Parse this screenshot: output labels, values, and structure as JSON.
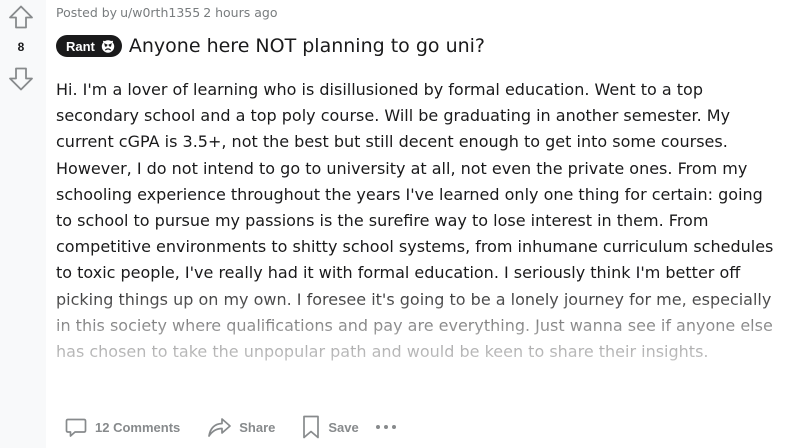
{
  "post": {
    "score": "8",
    "meta": {
      "posted_by": "Posted by",
      "author": "u/w0rth1355",
      "time": "2 hours ago"
    },
    "flair": {
      "label": "Rant",
      "icon": "angry-face-emoji-icon"
    },
    "title": "Anyone here NOT planning to go uni?",
    "body": "Hi. I'm a lover of learning who is disillusioned by formal education. Went to a top secondary school and a top poly course. Will be graduating in another semester. My current cGPA is 3.5+, not the best but still decent enough to get into some courses. However, I do not intend to go to university at all, not even the private ones. From my schooling experience throughout the years I've learned only one thing for certain: going to school to pursue my passions is the surefire way to lose interest in them. From competitive environments to shitty school systems, from inhumane curriculum schedules to toxic people, I've really had it with formal education. I seriously think I'm better off picking things up on my own. I foresee it's going to be a lonely journey for me, especially in this society where qualifications and pay are everything. Just wanna see if anyone else has chosen to take the unpopular path and would be keen to share their insights."
  },
  "actions": {
    "comments_label": "12 Comments",
    "share_label": "Share",
    "save_label": "Save"
  },
  "icons": {
    "upvote": "upvote-arrow-icon",
    "downvote": "downvote-arrow-icon",
    "comments": "comment-bubble-icon",
    "share": "share-arrow-icon",
    "save": "bookmark-icon",
    "more": "more-options-icon"
  },
  "colors": {
    "vote_column_bg": "#f8f9fa",
    "icon_gray": "#878a8c",
    "text_primary": "#1a1a1b",
    "text_meta": "#787c7e",
    "flair_bg": "#1a1a1b",
    "flair_text": "#ffffff"
  }
}
